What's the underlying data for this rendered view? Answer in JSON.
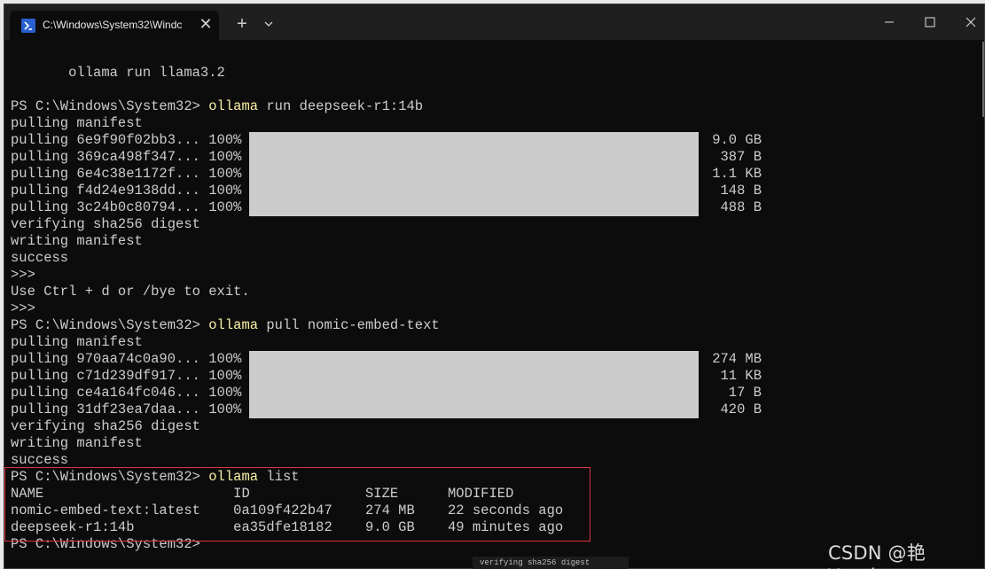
{
  "window": {
    "tab_title": "C:\\Windows\\System32\\Windc",
    "tab_close": "✕",
    "new_tab": "+"
  },
  "colors": {
    "command": "#f9f1a5",
    "text": "#cccccc",
    "background": "#0c0c0c",
    "progress_bar": "#cccccc",
    "highlight_box": "#d9363e"
  },
  "terminal": {
    "intro": "       ollama run llama3.2",
    "blocks": [
      {
        "prompt": "PS C:\\Windows\\System32> ",
        "command": "ollama",
        "args": " run deepseek-r1:14b"
      },
      {
        "prompt": "PS C:\\Windows\\System32> ",
        "command": "ollama",
        "args": " pull nomic-embed-text"
      },
      {
        "prompt": "PS C:\\Windows\\System32> ",
        "command": "ollama",
        "args": " list"
      },
      {
        "prompt": "PS C:\\Windows\\System32> "
      }
    ],
    "pull1": {
      "manifest": "pulling manifest",
      "rows": [
        {
          "label": "pulling 6e9f90f02bb3... 100%",
          "progress": 1.0,
          "size": "9.0 GB"
        },
        {
          "label": "pulling 369ca498f347... 100%",
          "progress": 1.0,
          "size": "387 B"
        },
        {
          "label": "pulling 6e4c38e1172f... 100%",
          "progress": 1.0,
          "size": "1.1 KB"
        },
        {
          "label": "pulling f4d24e9138dd... 100%",
          "progress": 1.0,
          "size": "148 B"
        },
        {
          "label": "pulling 3c24b0c80794... 100%",
          "progress": 1.0,
          "size": "488 B"
        }
      ],
      "verifying": "verifying sha256 digest",
      "writing": "writing manifest",
      "success": "success"
    },
    "repl": [
      ">>>",
      "Use Ctrl + d or /bye to exit.",
      ">>>"
    ],
    "pull2": {
      "manifest": "pulling manifest",
      "rows": [
        {
          "label": "pulling 970aa74c0a90... 100%",
          "progress": 1.0,
          "size": "274 MB"
        },
        {
          "label": "pulling c71d239df917... 100%",
          "progress": 1.0,
          "size": "11 KB"
        },
        {
          "label": "pulling ce4a164fc046... 100%",
          "progress": 1.0,
          "size": "17 B"
        },
        {
          "label": "pulling 31df23ea7daa... 100%",
          "progress": 1.0,
          "size": "420 B"
        }
      ],
      "verifying": "verifying sha256 digest",
      "writing": "writing manifest",
      "success": "success"
    },
    "list": {
      "header": "NAME                       ID              SIZE      MODIFIED",
      "rows": [
        "nomic-embed-text:latest    0a109f422b47    274 MB    22 seconds ago",
        "deepseek-r1:14b            ea35dfe18182    9.0 GB    49 minutes ago"
      ]
    }
  },
  "watermark": "CSDN @艳Yansky",
  "underlying_text": "verifying sha256 digest"
}
